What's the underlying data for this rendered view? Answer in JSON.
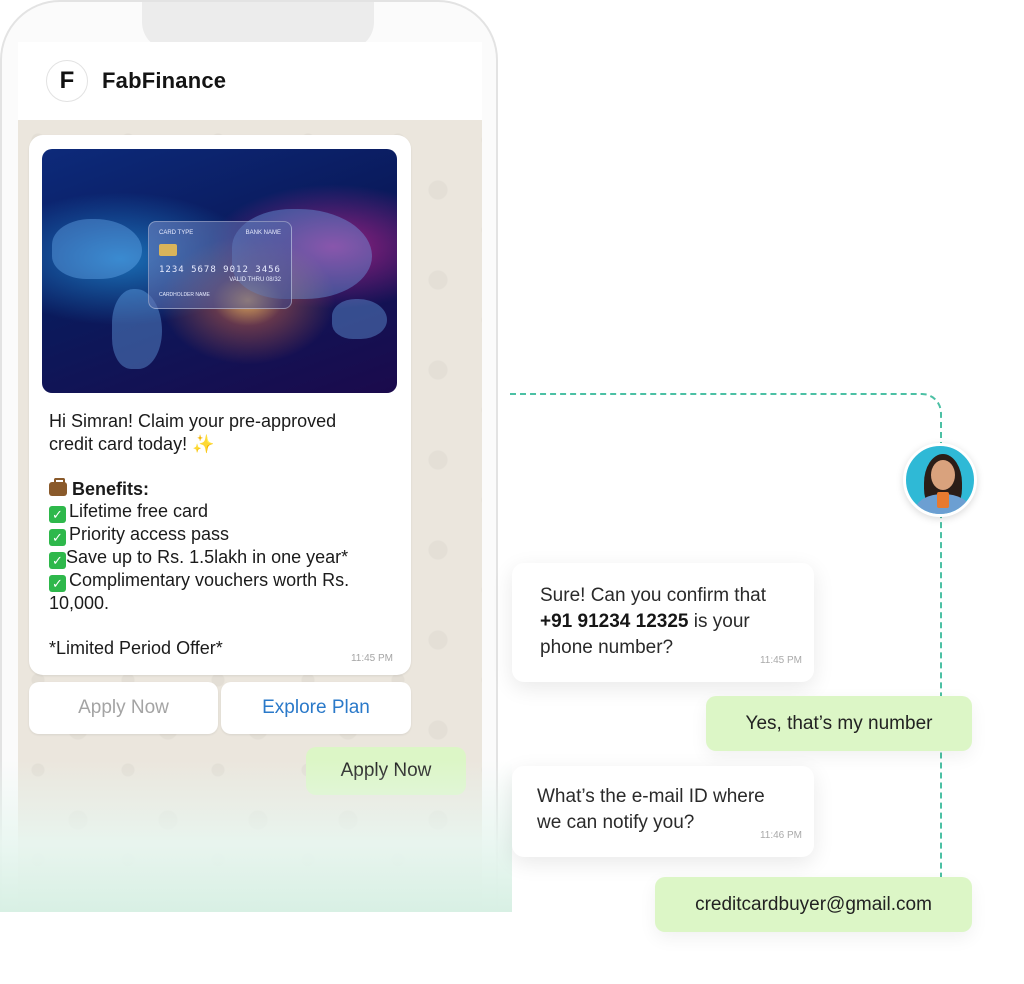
{
  "header": {
    "avatar_letter": "F",
    "app_name": "FabFinance"
  },
  "card_image": {
    "card_type": "CARD TYPE",
    "bank_name": "BANK NAME",
    "card_number": "1234 5678 9012 3456",
    "valid": "VALID THRU 08/32",
    "holder": "CARDHOLDER NAME"
  },
  "message": {
    "line1": "Hi Simran! Claim your pre-approved",
    "line2": "credit card today!",
    "benefits_title": "Benefits:",
    "benefit1": "Lifetime free card",
    "benefit2": "Priority access pass",
    "benefit3": "Save up to Rs. 1.5lakh in one year*",
    "benefit4a": "Complimentary vouchers worth Rs.",
    "benefit4b": "10,000.",
    "offer": "*Limited Period Offer*",
    "time": "11:45 PM"
  },
  "quick_replies": {
    "apply": "Apply Now",
    "explore": "Explore Plan"
  },
  "sent_message": "Apply Now",
  "conversation": {
    "bot1_pre": "Sure! Can you confirm that",
    "bot1_phone": "+91 91234 12325",
    "bot1_mid": "is your",
    "bot1_post": "phone number?",
    "bot1_time": "11:45 PM",
    "user1": "Yes, that’s my number",
    "bot2_line1": "What’s the e-mail ID where",
    "bot2_line2": "we can notify you?",
    "bot2_time": "11:46 PM",
    "user2": "creditcardbuyer@gmail.com"
  },
  "colors": {
    "accent_green": "#dcf6c6",
    "link_blue": "#2a79c9",
    "connector": "#4cc0a4"
  }
}
